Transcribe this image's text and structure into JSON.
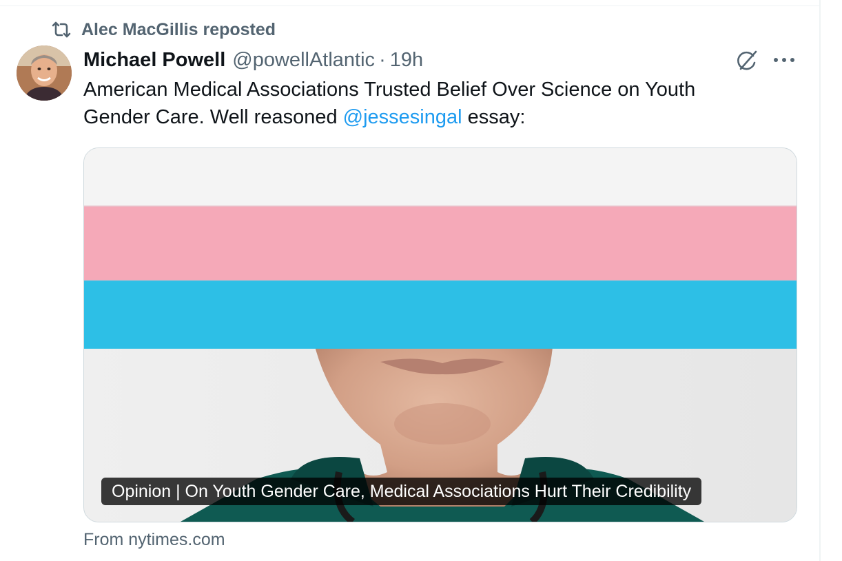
{
  "context": {
    "repost_icon": "repost-icon",
    "text": "Alec MacGillis reposted"
  },
  "tweet": {
    "author_name": "Michael Powell",
    "author_handle": "@powellAtlantic",
    "separator": "·",
    "timestamp": "19h",
    "text_line1": "American Medical Associations Trusted Belief Over Science on Youth",
    "text_line2_before": "Gender Care. Well reasoned ",
    "mention": "@jessesingal",
    "text_line2_after": " essay:",
    "grok_icon": "grok-icon",
    "more_icon": "more-horizontal-icon"
  },
  "card": {
    "caption": "Opinion | On Youth Gender Care, Medical Associations Hurt Their Credibility",
    "source": "From nytimes.com"
  },
  "colors": {
    "text_primary": "#0f1419",
    "text_secondary": "#536471",
    "link": "#1d9bf0",
    "stripe_white": "#f4f4f4",
    "stripe_pink": "#f5a9b8",
    "stripe_blue": "#2dbfe6"
  }
}
